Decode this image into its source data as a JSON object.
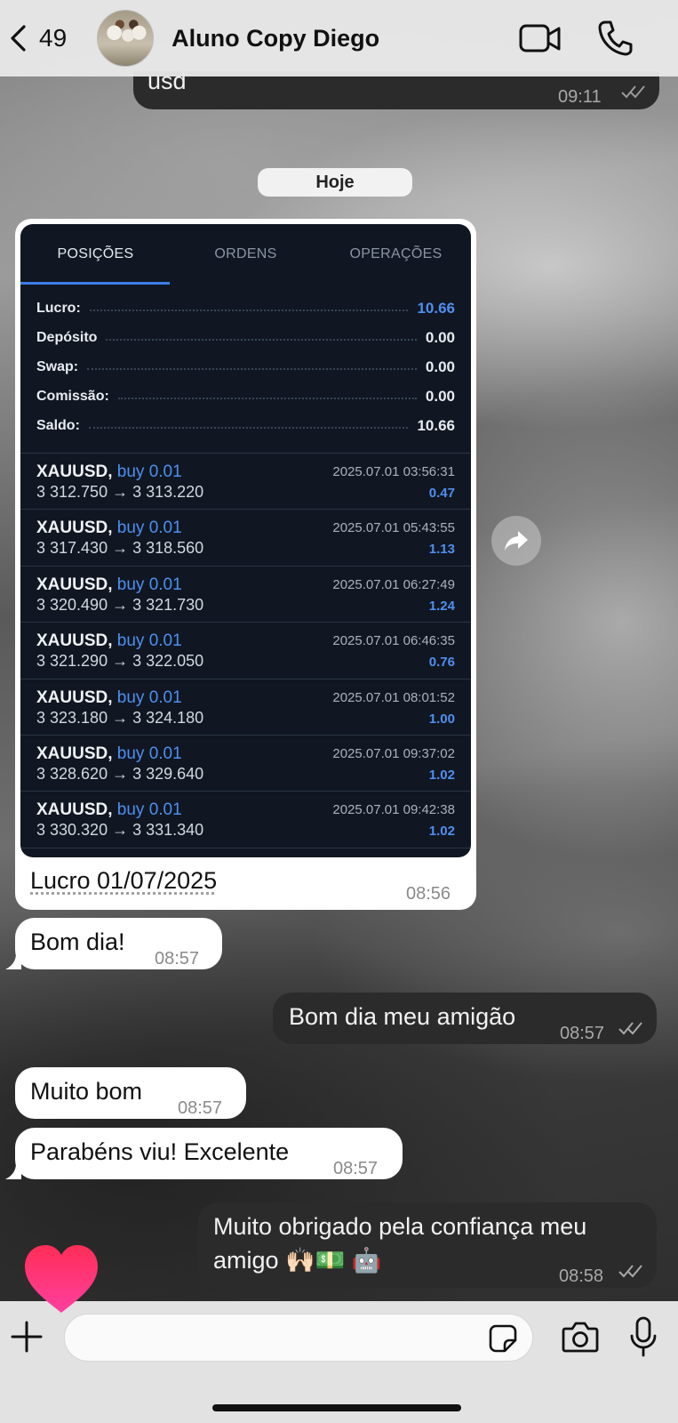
{
  "header": {
    "back_count": "49",
    "contact_name": "Aluno Copy Diego"
  },
  "top_bubble": {
    "text": "usd",
    "time": "09:11"
  },
  "date_pill": "Hoje",
  "screenshot": {
    "tabs": [
      "POSIÇÕES",
      "ORDENS",
      "OPERAÇÕES"
    ],
    "summary": [
      {
        "label": "Lucro:",
        "value": "10.66"
      },
      {
        "label": "Depósito",
        "value": "0.00"
      },
      {
        "label": "Swap:",
        "value": "0.00"
      },
      {
        "label": "Comissão:",
        "value": "0.00"
      },
      {
        "label": "Saldo:",
        "value": "10.66"
      }
    ],
    "trades": [
      {
        "symbol": "XAUUSD,",
        "side": "buy 0.01",
        "prices": "3 312.750 → 3 313.220",
        "datetime": "2025.07.01 03:56:31",
        "profit": "0.47"
      },
      {
        "symbol": "XAUUSD,",
        "side": "buy 0.01",
        "prices": "3 317.430 → 3 318.560",
        "datetime": "2025.07.01 05:43:55",
        "profit": "1.13"
      },
      {
        "symbol": "XAUUSD,",
        "side": "buy 0.01",
        "prices": "3 320.490 → 3 321.730",
        "datetime": "2025.07.01 06:27:49",
        "profit": "1.24"
      },
      {
        "symbol": "XAUUSD,",
        "side": "buy 0.01",
        "prices": "3 321.290 → 3 322.050",
        "datetime": "2025.07.01 06:46:35",
        "profit": "0.76"
      },
      {
        "symbol": "XAUUSD,",
        "side": "buy 0.01",
        "prices": "3 323.180 → 3 324.180",
        "datetime": "2025.07.01 08:01:52",
        "profit": "1.00"
      },
      {
        "symbol": "XAUUSD,",
        "side": "buy 0.01",
        "prices": "3 328.620 → 3 329.640",
        "datetime": "2025.07.01 09:37:02",
        "profit": "1.02"
      },
      {
        "symbol": "XAUUSD,",
        "side": "buy 0.01",
        "prices": "3 330.320 → 3 331.340",
        "datetime": "2025.07.01 09:42:38",
        "profit": "1.02"
      }
    ]
  },
  "messages": {
    "image_caption": "Lucro 01/07/2025",
    "image_time": "08:56",
    "m1": {
      "text": "Bom dia!",
      "time": "08:57"
    },
    "m2": {
      "text": "Bom dia meu amigão",
      "time": "08:57"
    },
    "m3": {
      "text": "Muito bom",
      "time": "08:57"
    },
    "m4": {
      "text": "Parabéns viu! Excelente",
      "time": "08:57"
    },
    "m5": {
      "line1": "Muito obrigado pela confiança meu",
      "line2": "amigo 🙌🏻💵 🤖",
      "time": "08:58"
    }
  },
  "colors": {
    "accent_blue": "#4f8ff0",
    "outgoing_bubble": "#2b2b2b",
    "incoming_bubble": "#ffffff",
    "heart": "#ff2d6f"
  },
  "icons": [
    "chevron-left-icon",
    "video-call-icon",
    "phone-icon",
    "forward-icon",
    "plus-icon",
    "sticker-icon",
    "camera-icon",
    "microphone-icon",
    "heart-reaction-icon",
    "double-check-icon"
  ]
}
